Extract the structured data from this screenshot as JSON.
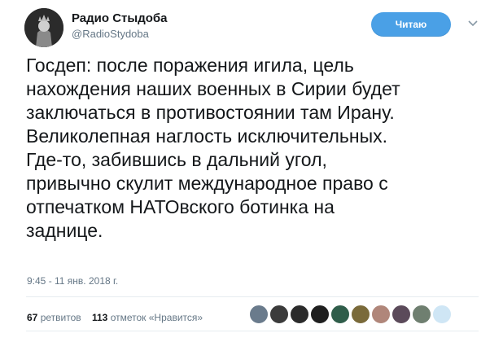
{
  "user": {
    "name": "Радио Стыдоба",
    "handle": "@RadioStydoba"
  },
  "follow_button": {
    "label": "Читаю"
  },
  "tweet": {
    "lines": [
      "Госдеп: после поражения игила, цель",
      "нахождения наших военных в Сирии будет",
      "заключаться в противостоянии там Ирану.",
      "Великолепная наглость исключительных.",
      "Где-то, забившись в дальний угол,",
      "привычно скулит международное право с",
      "отпечатком НАТОвского ботинка на",
      "заднице."
    ],
    "timestamp": "9:45 - 11 янв. 2018 г."
  },
  "stats": {
    "retweets_count": "67",
    "retweets_label": "ретвитов",
    "likes_count": "113",
    "likes_label": "отметок «Нравится»"
  },
  "likers": {
    "colors": [
      "#6a7b8c",
      "#3b3b3b",
      "#2b2b2b",
      "#1f1f1f",
      "#2f5d4a",
      "#7a6a3a",
      "#b0867a",
      "#5b4a5a",
      "#6f7f70",
      "#cfe6f5"
    ]
  }
}
